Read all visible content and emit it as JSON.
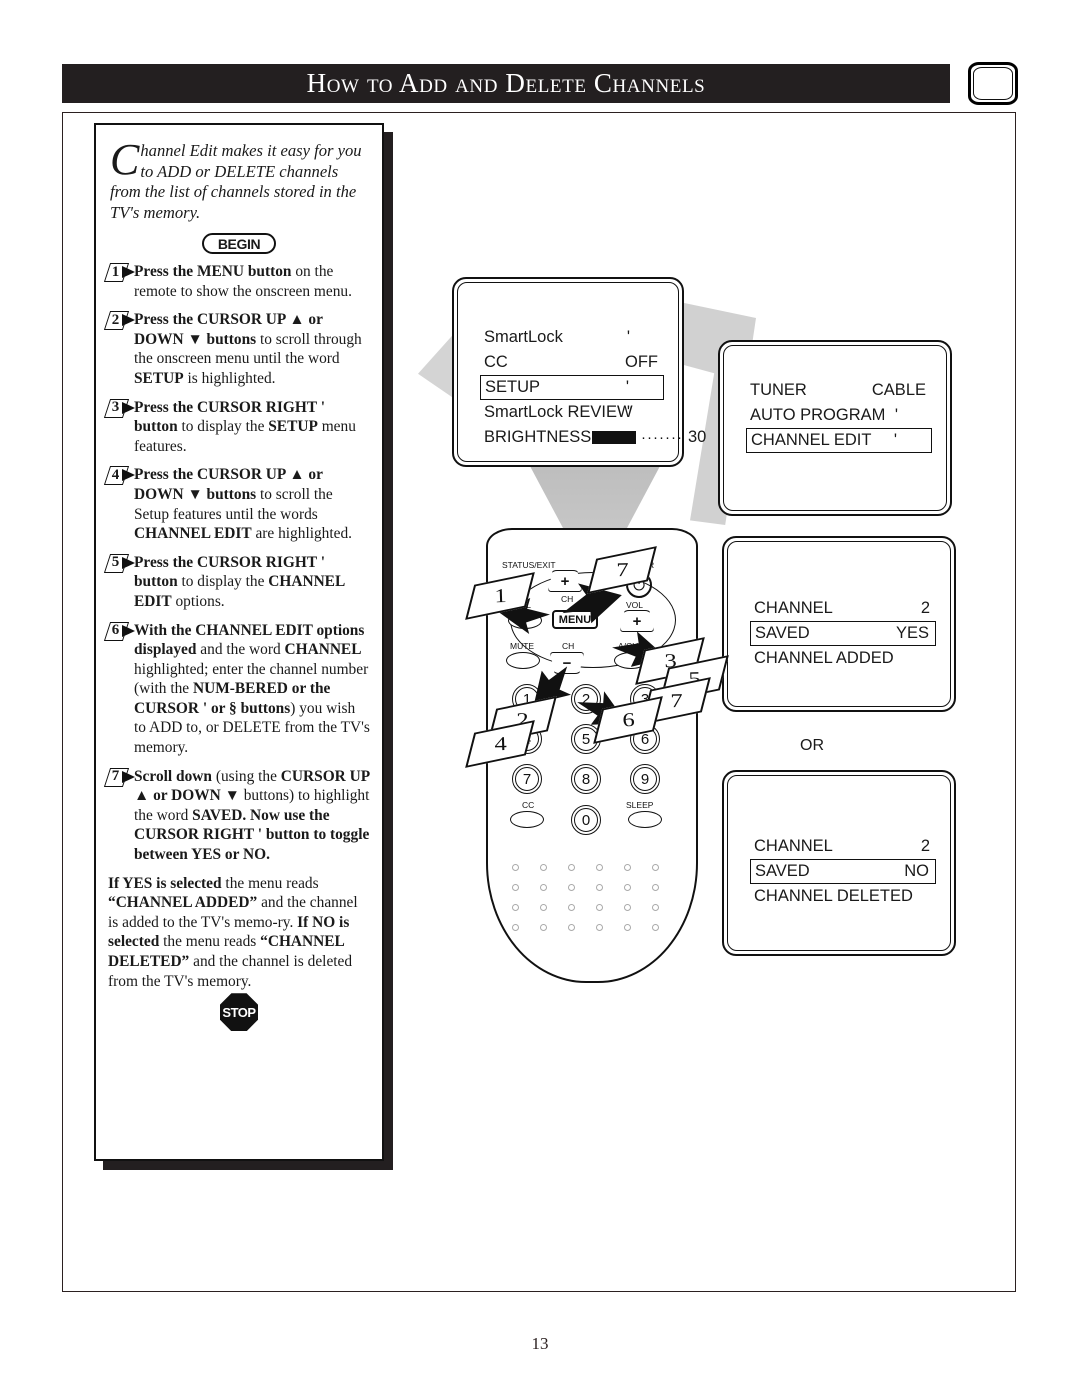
{
  "page": {
    "title": "How to Add and Delete Channels",
    "number": "13",
    "tv_icon_name": "tv-screen-icon"
  },
  "instructions": {
    "intro_dropcap": "C",
    "intro_line1": "hannel Edit makes it easy for you",
    "intro_line2": "to ADD or DELETE channels",
    "intro_line3": "from the list of channels stored in the TV's memory.",
    "begin_label": "BEGIN",
    "stop_label": "STOP",
    "steps": [
      {
        "number": "1",
        "lead": "Press the MENU button",
        "rest": " on the remote to show the onscreen menu."
      },
      {
        "number": "2",
        "lead": "Press the CURSOR UP ▲ or DOWN ▼ buttons",
        "rest": " to scroll through the onscreen menu until the word ",
        "tail_bold": "SETUP",
        "tail_rest": " is highlighted."
      },
      {
        "number": "3",
        "lead": "Press the CURSOR RIGHT ' button",
        "rest": " to display the ",
        "tail_bold": "SETUP",
        "tail_rest": " menu features."
      },
      {
        "number": "4",
        "lead": "Press the CURSOR UP ▲ or DOWN ▼ buttons",
        "rest": " to scroll the Setup features until the words ",
        "tail_bold": "CHANNEL EDIT",
        "tail_rest": " are highlighted."
      },
      {
        "number": "5",
        "lead": "Press the CURSOR RIGHT ' button",
        "rest": " to display the ",
        "tail_bold": "CHANNEL EDIT",
        "tail_rest": " options."
      },
      {
        "number": "6",
        "lead": "With the CHANNEL EDIT options displayed",
        "rest": " and the word ",
        "tail_bold": "CHANNEL",
        "tail_rest": " highlighted; enter the channel number (with the "
      },
      {
        "number": "7",
        "lead": "Scroll down",
        "rest": " (using the "
      }
    ],
    "step6_bold_2": "NUM-BERED or the CURSOR '    or § buttons",
    "step6_rest_2": ") you wish to ADD to, or DELETE from the TV's memory.",
    "step7_bold_2": "CURSOR UP ▲ or DOWN ▼",
    "step7_mid": " buttons) to highlight the word ",
    "step7_bold_3": "SAVED.",
    "step7_bold_4": "Now use the CURSOR RIGHT ' button to toggle between YES or NO.",
    "result_bold_1": "If YES is selected",
    "result_text_1": " the menu reads ",
    "result_bold_2": "“CHANNEL ADDED”",
    "result_text_2": " and the channel is added to the TV's memo-ry. ",
    "result_bold_3": "If NO is selected",
    "result_text_3": " the menu reads ",
    "result_bold_4": "“CHANNEL DELETED”",
    "result_text_4": " and the channel is deleted from the TV's memory."
  },
  "screens": {
    "main_menu": {
      "rows": [
        {
          "label": "SmartLock",
          "value": "'",
          "value_pos": "mid",
          "highlighted": false
        },
        {
          "label": "CC",
          "value": "OFF",
          "value_pos": "right",
          "highlighted": false
        },
        {
          "label": "SETUP",
          "value": "'",
          "value_pos": "mid",
          "highlighted": true
        },
        {
          "label": "SmartLock REVIEW",
          "value": "'",
          "value_pos": "mid",
          "highlighted": false
        }
      ],
      "brightness_label": "BRIGHTNESS",
      "brightness_dots": "·······",
      "brightness_value": "30"
    },
    "setup_menu": {
      "rows": [
        {
          "label": "TUNER",
          "value": "CABLE",
          "value_pos": "right",
          "highlighted": false
        },
        {
          "label": "AUTO PROGRAM",
          "value": "'",
          "value_pos": "mid",
          "highlighted": false
        },
        {
          "label": "CHANNEL EDIT",
          "value": "'",
          "value_pos": "mid",
          "highlighted": true
        }
      ]
    },
    "channel_added": {
      "rows": [
        {
          "label": "CHANNEL",
          "value": "2",
          "value_pos": "right",
          "highlighted": false
        },
        {
          "label": "SAVED",
          "value": "YES",
          "value_pos": "right",
          "highlighted": true
        },
        {
          "label": "CHANNEL ADDED",
          "value": "",
          "value_pos": "right",
          "highlighted": false
        }
      ]
    },
    "channel_deleted": {
      "rows": [
        {
          "label": "CHANNEL",
          "value": "2",
          "value_pos": "right",
          "highlighted": false
        },
        {
          "label": "SAVED",
          "value": "NO",
          "value_pos": "right",
          "highlighted": true
        },
        {
          "label": "CHANNEL DELETED",
          "value": "",
          "value_pos": "right",
          "highlighted": false
        }
      ]
    },
    "or_label": "OR"
  },
  "remote": {
    "labels": {
      "status_exit": "STATUS/EXIT",
      "power": "POWER",
      "vol_left": "VOL",
      "vol_right": "VOL",
      "ch_top": "CH",
      "ch_bottom": "CH",
      "mute": "MUTE",
      "ach": "A/CH",
      "cc": "CC",
      "sleep": "SLEEP",
      "menu": "MENU",
      "power_glyph": "⏻",
      "plus": "+",
      "minus": "−"
    },
    "keypad": [
      "1",
      "2",
      "3",
      "4",
      "5",
      "6",
      "7",
      "8",
      "9",
      "0"
    ],
    "callouts": [
      "1",
      "7",
      "3",
      "5",
      "7",
      "2",
      "4",
      "6"
    ]
  }
}
